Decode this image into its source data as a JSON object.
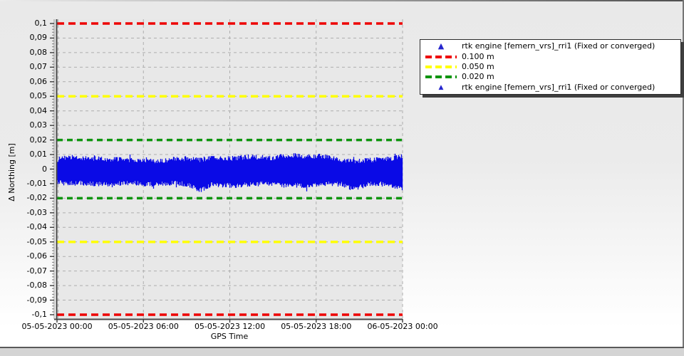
{
  "frame": {
    "bg_top": "#e9e9e9",
    "bg_bottom": "#ffffff",
    "border_dark": "#5a5a5a",
    "bottom_bar_color": "#d4d4d4"
  },
  "chart_data": {
    "type": "line",
    "title": "",
    "xlabel": "GPS Time",
    "ylabel": "Δ Northing [m]",
    "x_tick_labels": [
      "05-05-2023 00:00",
      "05-05-2023 06:00",
      "05-05-2023 12:00",
      "05-05-2023 18:00",
      "06-05-2023 00:00"
    ],
    "y_tick_labels": [
      "0,1",
      "0,09",
      "0,08",
      "0,07",
      "0,06",
      "0,05",
      "0,04",
      "0,03",
      "0,02",
      "0,01",
      "0",
      "-0,01",
      "-0,02",
      "-0,03",
      "-0,04",
      "-0,05",
      "-0,06",
      "-0,07",
      "-0,08",
      "-0,09",
      "-0,1"
    ],
    "y_tick_values": [
      0.1,
      0.09,
      0.08,
      0.07,
      0.06,
      0.05,
      0.04,
      0.03,
      0.02,
      0.01,
      0,
      -0.01,
      -0.02,
      -0.03,
      -0.04,
      -0.05,
      -0.06,
      -0.07,
      -0.08,
      -0.09,
      -0.1
    ],
    "ylim": [
      -0.1,
      0.1
    ],
    "xlim_hours": [
      0,
      24
    ],
    "grid": {
      "show": true,
      "color": "#aeaeae",
      "dash": "4 4"
    },
    "plot_bg": "#e8e8e8",
    "axis_color": "#4a4a4a",
    "reference_lines": [
      {
        "label": "0.100 m",
        "value_m": 0.1,
        "mirrored": true,
        "color": "#ee0000",
        "dash": "10 6",
        "width": 3.5
      },
      {
        "label": "0.050 m",
        "value_m": 0.05,
        "mirrored": true,
        "color": "#ffff00",
        "dash": "10 6",
        "width": 3.5
      },
      {
        "label": "0.020 m",
        "value_m": 0.02,
        "mirrored": true,
        "color": "#0d940d",
        "dash": "8 6",
        "width": 3.5
      }
    ],
    "series": [
      {
        "name": "rtk engine [femern_vrs]_rri1 (Fixed or converged)",
        "style": "dense-noise-band",
        "color": "#0a0ae6",
        "seed": 1234,
        "noise_amplitude_m": 0.0017,
        "envelope_top_m": [
          0.0065,
          0.0085,
          0.007,
          0.0075,
          0.0065,
          0.007,
          0.006,
          0.0065,
          0.0055,
          0.006,
          0.0075,
          0.007,
          0.0065,
          0.008,
          0.007,
          0.0075,
          0.0085,
          0.008,
          0.0075,
          0.009,
          0.0095,
          0.0085,
          0.009,
          0.008,
          0.006,
          0.0055,
          0.006,
          0.0065,
          0.007,
          0.009
        ],
        "envelope_bottom_m": [
          -0.009,
          -0.01,
          -0.0095,
          -0.01,
          -0.0105,
          -0.01,
          -0.0095,
          -0.01,
          -0.0105,
          -0.01,
          -0.0095,
          -0.0105,
          -0.0145,
          -0.0105,
          -0.011,
          -0.0115,
          -0.0105,
          -0.01,
          -0.0105,
          -0.0115,
          -0.011,
          -0.012,
          -0.0105,
          -0.01,
          -0.0105,
          -0.014,
          -0.0105,
          -0.01,
          -0.011,
          -0.0135
        ]
      }
    ]
  },
  "legend": {
    "items": [
      {
        "label": "rtk engine [femern_vrs]_rri1 (Fixed or converged)",
        "marker": "triangle",
        "color": "#2525cd",
        "size": 11
      },
      {
        "label": "0.100 m",
        "marker": "dashes",
        "color": "#ee0000"
      },
      {
        "label": "0.050 m",
        "marker": "dashes",
        "color": "#ffff00"
      },
      {
        "label": "0.020 m",
        "marker": "dashes",
        "color": "#0d940d"
      },
      {
        "label": "rtk engine [femern_vrs]_rri1 (Fixed or converged)",
        "marker": "triangle",
        "color": "#2525cd",
        "size": 9
      }
    ]
  }
}
